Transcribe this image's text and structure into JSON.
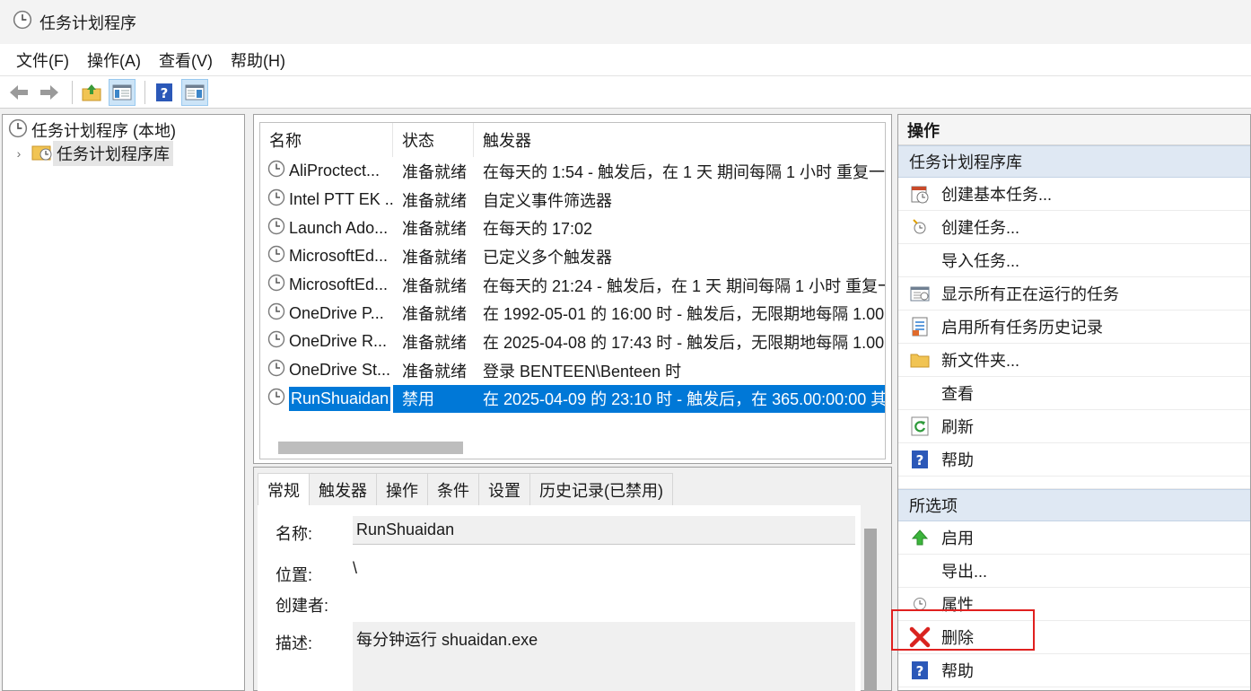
{
  "window": {
    "title": "任务计划程序"
  },
  "menu": [
    {
      "label": "文件(F)"
    },
    {
      "label": "操作(A)"
    },
    {
      "label": "查看(V)"
    },
    {
      "label": "帮助(H)"
    }
  ],
  "toolbar": {
    "icons": [
      "back-arrow-icon",
      "forward-arrow-icon",
      "up-folder-icon",
      "show-hide-tree-icon",
      "help-icon",
      "show-hide-action-pane-icon"
    ]
  },
  "tree": {
    "root": "任务计划程序 (本地)",
    "child": "任务计划程序库",
    "expander": "›"
  },
  "task_list": {
    "columns": [
      "名称",
      "状态",
      "触发器"
    ],
    "rows": [
      {
        "name": "AliProctect...",
        "status": "准备就绪",
        "trigger": "在每天的 1:54 - 触发后，在 1 天 期间每隔 1 小时 重复一"
      },
      {
        "name": "Intel PTT EK ...",
        "status": "准备就绪",
        "trigger": "自定义事件筛选器"
      },
      {
        "name": "Launch Ado...",
        "status": "准备就绪",
        "trigger": "在每天的 17:02"
      },
      {
        "name": "MicrosoftEd...",
        "status": "准备就绪",
        "trigger": "已定义多个触发器"
      },
      {
        "name": "MicrosoftEd...",
        "status": "准备就绪",
        "trigger": "在每天的 21:24 - 触发后，在 1 天 期间每隔 1 小时 重复一"
      },
      {
        "name": "OneDrive P...",
        "status": "准备就绪",
        "trigger": "在 1992-05-01 的 16:00 时 - 触发后，无限期地每隔 1.00"
      },
      {
        "name": "OneDrive R...",
        "status": "准备就绪",
        "trigger": "在 2025-04-08 的 17:43 时 - 触发后，无限期地每隔 1.00"
      },
      {
        "name": "OneDrive St...",
        "status": "准备就绪",
        "trigger": "登录 BENTEEN\\Benteen 时"
      },
      {
        "name": "RunShuaidan",
        "status": "禁用",
        "trigger": "在 2025-04-09 的 23:10 时 - 触发后，在 365.00:00:00 其"
      }
    ],
    "selected_index": 8
  },
  "details": {
    "tabs": [
      "常规",
      "触发器",
      "操作",
      "条件",
      "设置",
      "历史记录(已禁用)"
    ],
    "active_tab": 0,
    "name_label": "名称:",
    "name_value": "RunShuaidan",
    "location_label": "位置:",
    "location_value": "\\",
    "author_label": "创建者:",
    "author_value": "",
    "description_label": "描述:",
    "description_value": "每分钟运行 shuaidan.exe"
  },
  "actions": {
    "title": "操作",
    "section1": "任务计划程序库",
    "items1": [
      {
        "label": "创建基本任务...",
        "icon": "create-basic-task-icon"
      },
      {
        "label": "创建任务...",
        "icon": "create-task-icon"
      },
      {
        "label": "导入任务...",
        "icon": ""
      },
      {
        "label": "显示所有正在运行的任务",
        "icon": "running-tasks-icon"
      },
      {
        "label": "启用所有任务历史记录",
        "icon": "history-icon"
      },
      {
        "label": "新文件夹...",
        "icon": "new-folder-icon"
      },
      {
        "label": "查看",
        "icon": ""
      },
      {
        "label": "刷新",
        "icon": "refresh-icon"
      },
      {
        "label": "帮助",
        "icon": "help-icon"
      }
    ],
    "section2": "所选项",
    "items2": [
      {
        "label": "启用",
        "icon": "enable-arrow-icon"
      },
      {
        "label": "导出...",
        "icon": ""
      },
      {
        "label": "属性",
        "icon": "properties-icon"
      },
      {
        "label": "删除",
        "icon": "delete-x-icon"
      },
      {
        "label": "帮助",
        "icon": "help-icon"
      }
    ],
    "highlight_color": "#e0201f"
  }
}
